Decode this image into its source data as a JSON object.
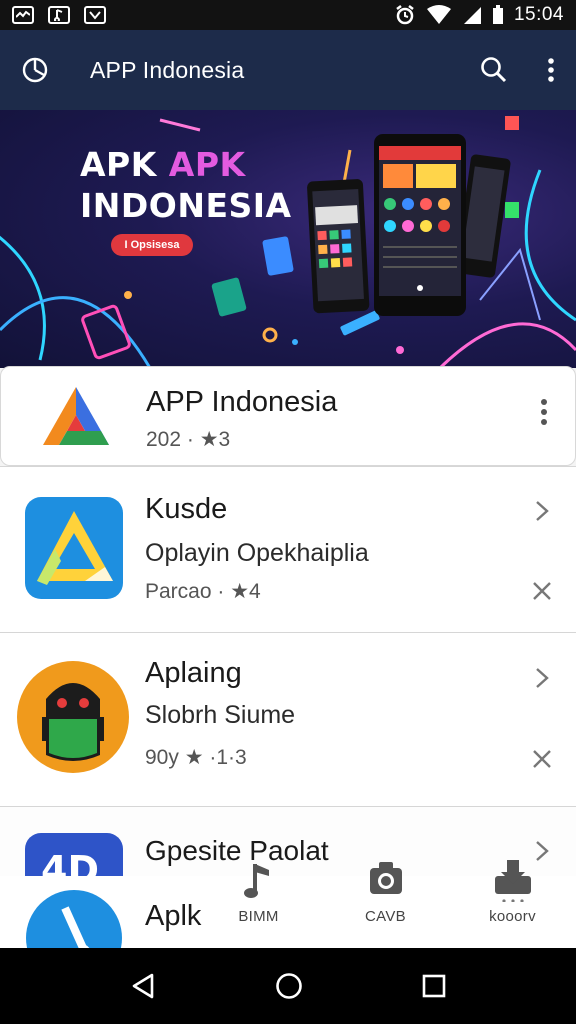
{
  "status_bar": {
    "time": "15:04"
  },
  "app_bar": {
    "title": "APP Indonesia"
  },
  "banner": {
    "line1_white": "APK ",
    "line1_pink": "APK",
    "line2": "INDONESIA",
    "badge": "I Opsisesa"
  },
  "apps": [
    {
      "title": "APP Indonesia",
      "meta": "202 · ★3"
    },
    {
      "title": "Kusde",
      "subtitle": "Oplayin Opekhaiplia",
      "meta": "Parcao · ★4"
    },
    {
      "title": "Aplaing",
      "subtitle": "Slobrh Siume",
      "meta": "90y  ★ ·1·3"
    },
    {
      "title": "Gpesite Paolat"
    },
    {
      "title": "Aplk"
    }
  ],
  "bottom_nav": [
    {
      "label": "BIMM",
      "icon": "music-note-icon"
    },
    {
      "label": "CAVB",
      "icon": "camera-icon"
    },
    {
      "label": "kooorv",
      "icon": "download-icon"
    }
  ],
  "colors": {
    "app_bar": "#1d2b4a",
    "accent_pink": "#e35be0",
    "badge_red": "#e0383e"
  }
}
